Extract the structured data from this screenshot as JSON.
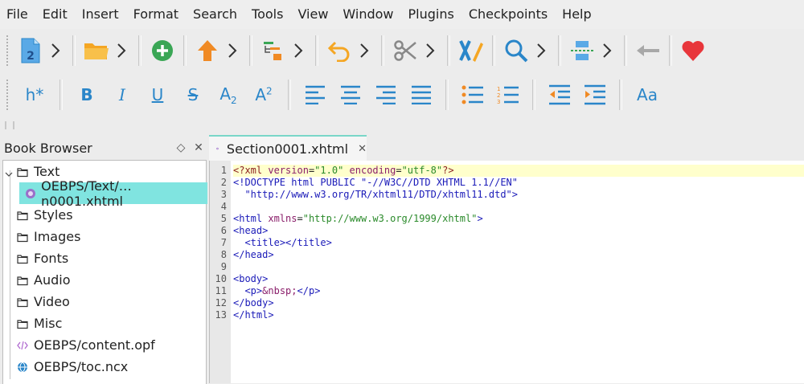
{
  "menu": [
    "File",
    "Edit",
    "Insert",
    "Format",
    "Search",
    "Tools",
    "View",
    "Window",
    "Plugins",
    "Checkpoints",
    "Help"
  ],
  "toolbar1": {
    "icons": [
      "new-epub-icon",
      "open-folder-icon",
      "add-file-icon",
      "move-up-icon",
      "toc-icon",
      "undo-icon",
      "cut-icon",
      "spellcheck-icon",
      "find-icon",
      "split-icon",
      "back-icon",
      "donate-heart-icon"
    ],
    "new_badge": "2"
  },
  "toolbar2": {
    "heading": "h*",
    "bold": "B",
    "italic": "I",
    "underline": "U",
    "strike": "S",
    "subscript": "A",
    "subscript_mark": "2",
    "superscript": "A",
    "superscript_mark": "2",
    "case": "Aa"
  },
  "book_browser": {
    "title": "Book Browser",
    "float_glyph": "◇",
    "close_glyph": "✕",
    "items": [
      {
        "label": "Text",
        "kind": "folder"
      },
      {
        "label": "OEBPS/Text/…n0001.xhtml",
        "kind": "xhtml",
        "selected": true
      },
      {
        "label": "Styles",
        "kind": "folder"
      },
      {
        "label": "Images",
        "kind": "folder"
      },
      {
        "label": "Fonts",
        "kind": "folder"
      },
      {
        "label": "Audio",
        "kind": "folder"
      },
      {
        "label": "Video",
        "kind": "folder"
      },
      {
        "label": "Misc",
        "kind": "folder"
      },
      {
        "label": "OEBPS/content.opf",
        "kind": "opf"
      },
      {
        "label": "OEBPS/toc.ncx",
        "kind": "ncx"
      }
    ]
  },
  "editor": {
    "tab_label": "Section0001.xhtml",
    "tab_close": "✕",
    "line_numbers": [
      "1",
      "2",
      "3",
      "4",
      "5",
      "6",
      "7",
      "8",
      "9",
      "10",
      "11",
      "12",
      "13"
    ],
    "lines": [
      "<?xml version=\"1.0\" encoding=\"utf-8\"?>",
      "<!DOCTYPE html PUBLIC \"-//W3C//DTD XHTML 1.1//EN\"",
      "  \"http://www.w3.org/TR/xhtml11/DTD/xhtml11.dtd\">",
      "",
      "<html xmlns=\"http://www.w3.org/1999/xhtml\">",
      "<head>",
      "  <title></title>",
      "</head>",
      "",
      "<body>",
      "  <p>&nbsp;</p>",
      "</body>",
      "</html>"
    ],
    "current_line": 1
  },
  "colors": {
    "selection": "#80e4e0",
    "tab_accent": "#79d6c8",
    "current_line": "#ffffcc",
    "icon_blue": "#2a86c9"
  }
}
